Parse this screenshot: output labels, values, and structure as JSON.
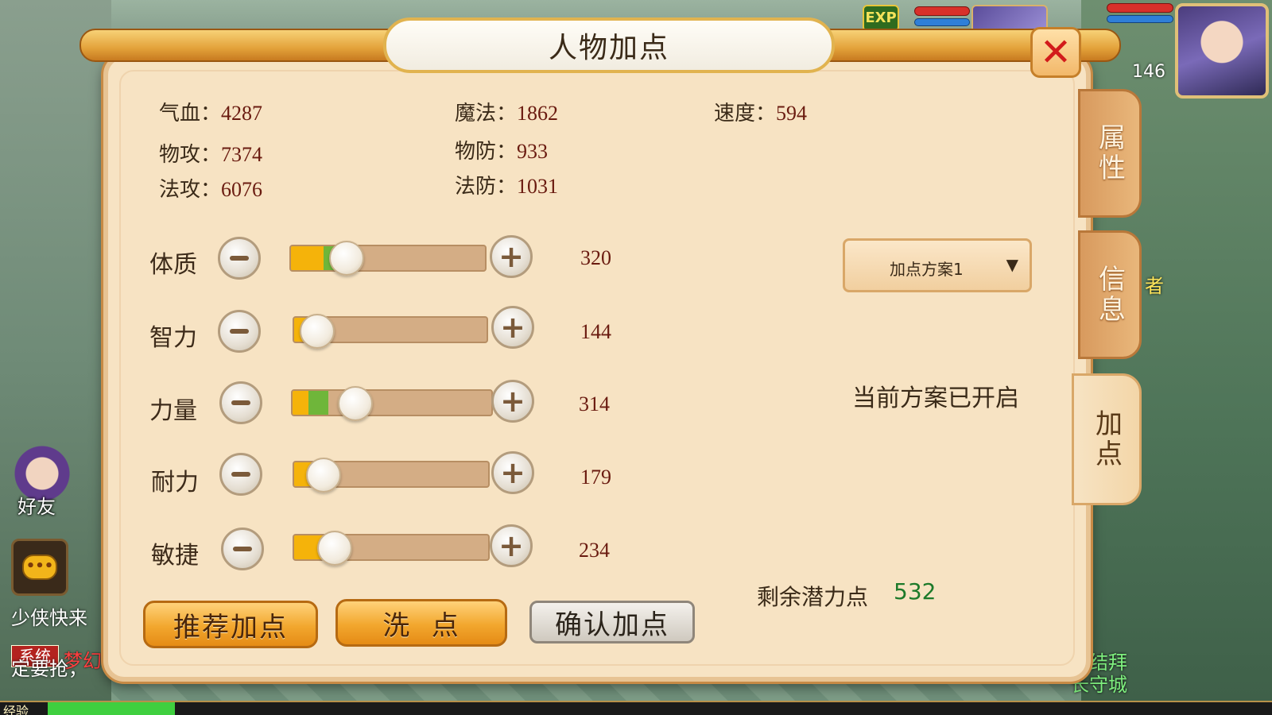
{
  "panel": {
    "title": "人物加点",
    "close_icon": "close-icon"
  },
  "stats": {
    "hp_label": "气血：",
    "hp_value": "4287",
    "mp_label": "魔法：",
    "mp_value": "1862",
    "speed_label": "速度：",
    "speed_value": "594",
    "patk_label": "物攻：",
    "patk_value": "7374",
    "pdef_label": "物防：",
    "pdef_value": "933",
    "matk_label": "法攻：",
    "matk_value": "6076",
    "mdef_label": "法防：",
    "mdef_value": "1031"
  },
  "attributes": [
    {
      "label": "体质",
      "value": "320",
      "level": 0.25,
      "green": 0.08
    },
    {
      "label": "智力",
      "value": "144",
      "level": 0.12,
      "green": 0.0
    },
    {
      "label": "力量",
      "value": "314",
      "level": 0.18,
      "green": 0.1
    },
    {
      "label": "耐力",
      "value": "179",
      "level": 0.1,
      "green": 0.0
    },
    {
      "label": "敏捷",
      "value": "234",
      "level": 0.16,
      "green": 0.0
    }
  ],
  "scheme": {
    "selected": "加点方案1",
    "status": "当前方案已开启"
  },
  "remaining": {
    "label": "剩余潜力点",
    "value": "532"
  },
  "buttons": {
    "recommend": "推荐加点",
    "reset": "洗  点",
    "confirm": "确认加点"
  },
  "side_tabs": {
    "attributes": "属性",
    "info": "信息",
    "points": "加点"
  },
  "hud": {
    "exp_badge": "EXP",
    "player_level": "146",
    "friends": "好友",
    "chat_line_1": "少侠快来",
    "system_tag": "系统",
    "system_text": "梦幻",
    "chat_line_2": "定要抢，",
    "world_text_1": "者",
    "world_text_2": "结拜",
    "world_text_3": "长守城",
    "exp_label": "经验",
    "exp_fraction": 0.1
  },
  "colors": {
    "panel_bg": "#f7e3c3",
    "value_red": "#6a1b10",
    "remaining_green": "#1d7a2a",
    "slider_fill": "#f5b30a"
  }
}
